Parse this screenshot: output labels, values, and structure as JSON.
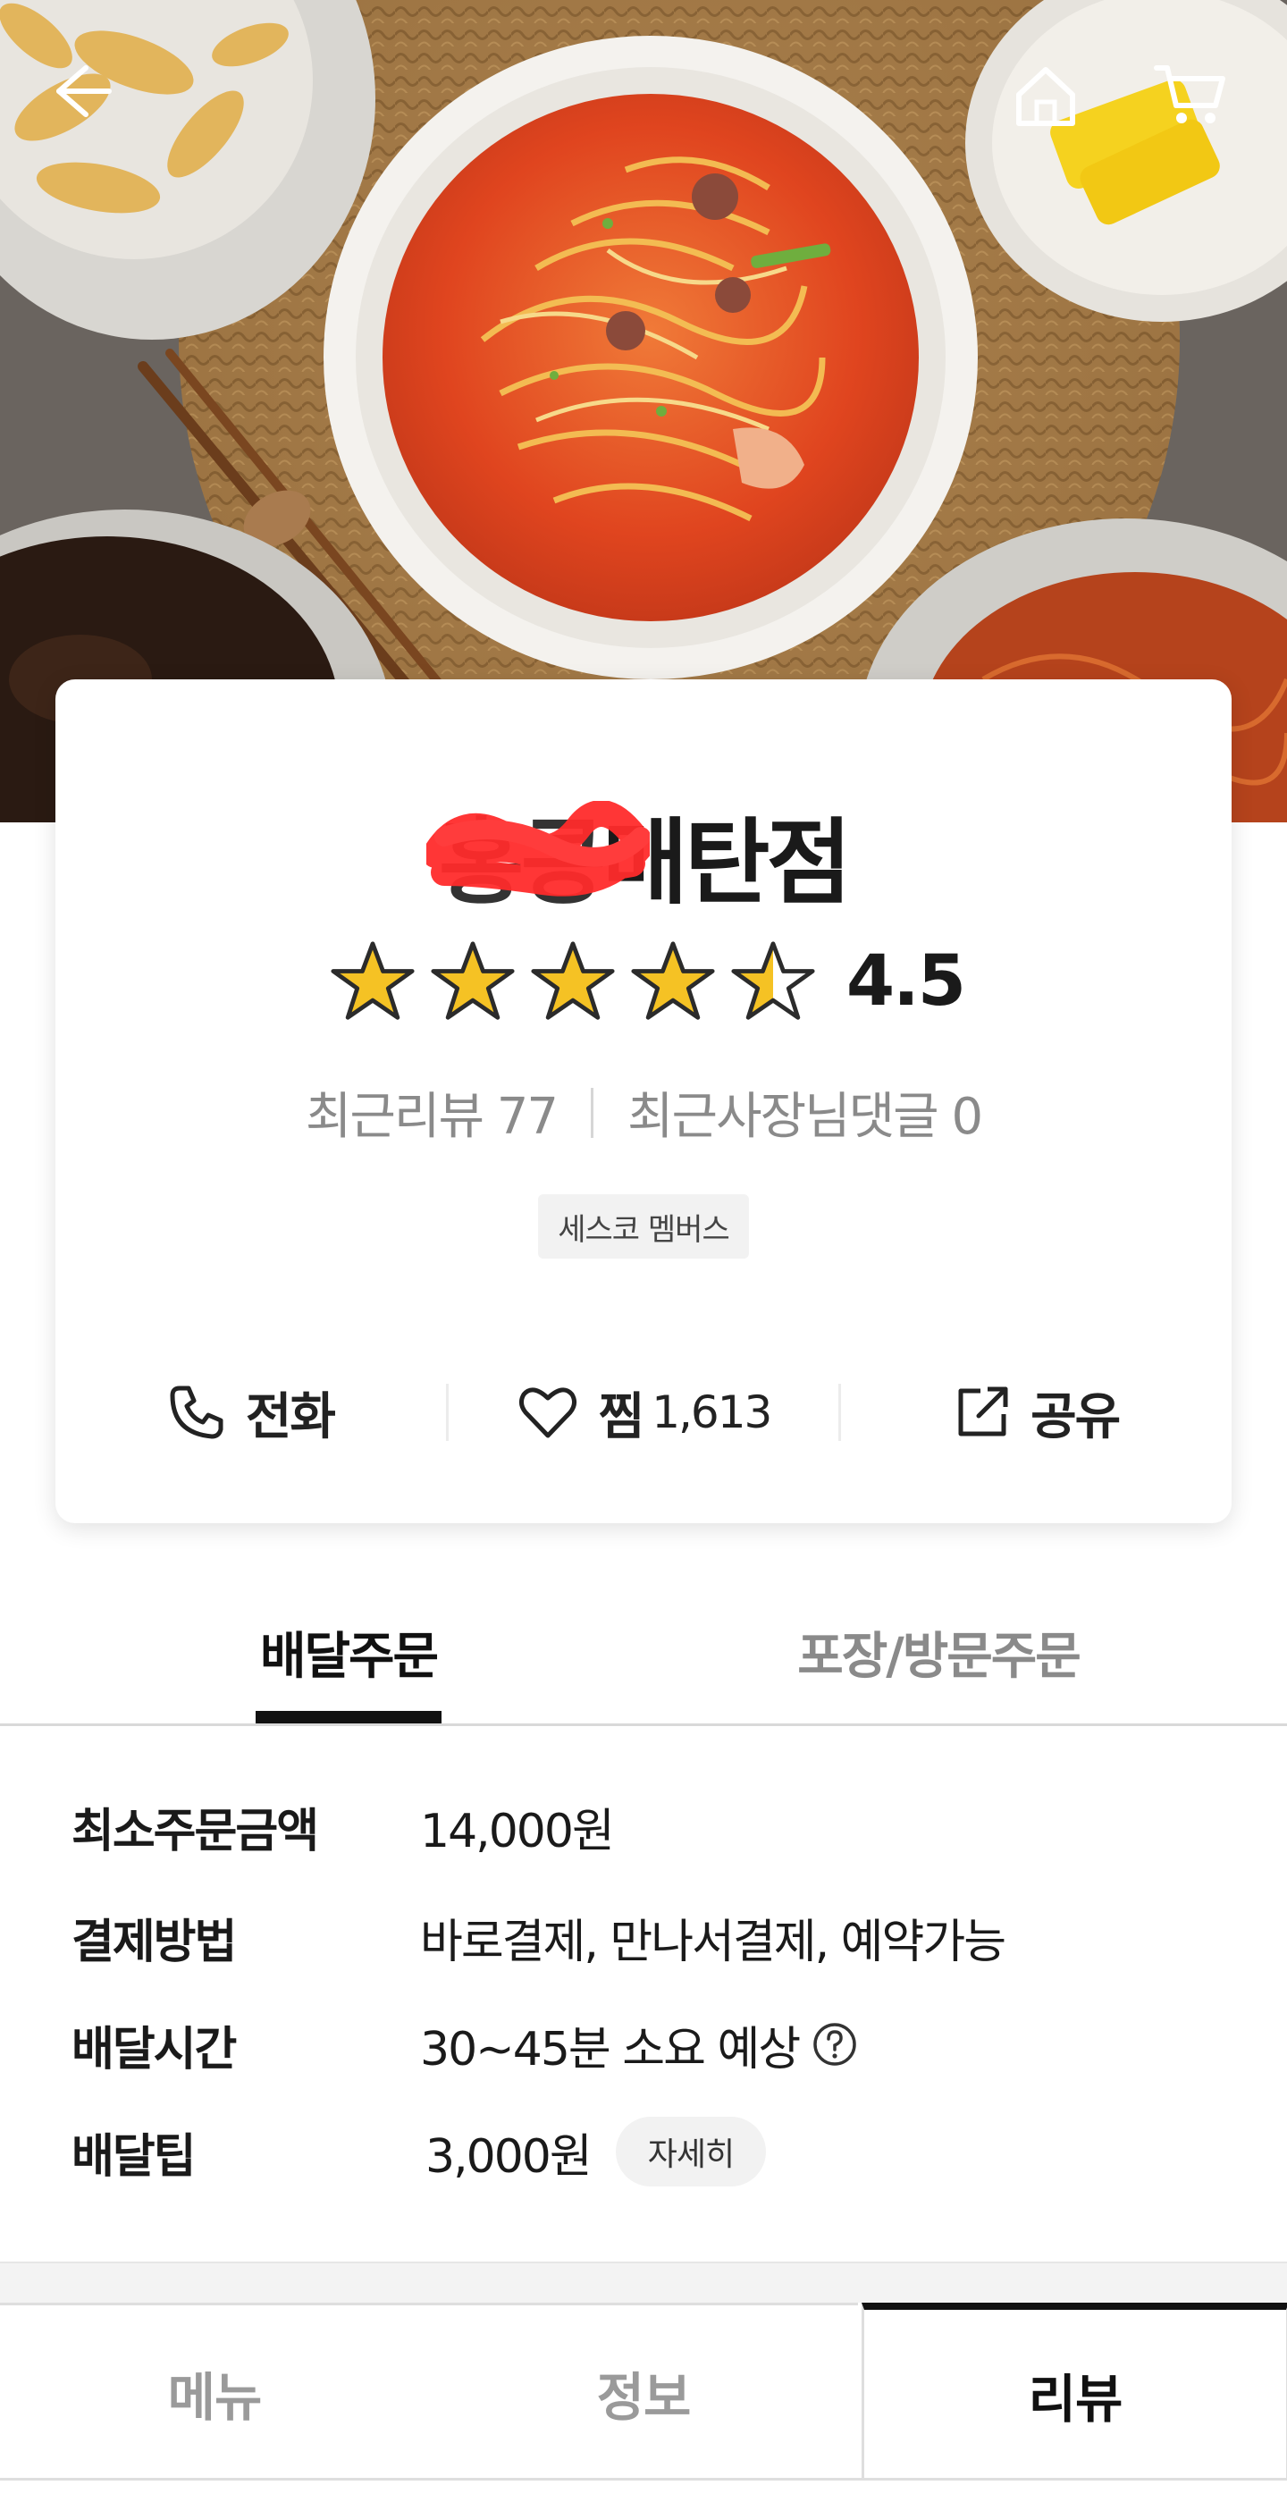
{
  "store": {
    "name_prefix": "홍콩",
    "name_suffix": "매탄점",
    "rating": "4.5",
    "recent_reviews": "최근리뷰 77",
    "recent_owner_replies": "최근사장님댓글 0",
    "badge": "세스코 멤버스"
  },
  "actions": {
    "call": "전화",
    "favorite": "찜",
    "favorite_count": "1,613",
    "share": "공유"
  },
  "order_tabs": {
    "delivery": "배달주문",
    "pickup": "포장/방문주문"
  },
  "info": [
    {
      "label": "최소주문금액",
      "value": "14,000원"
    },
    {
      "label": "결제방법",
      "value": "바로결제, 만나서결제, 예약가능"
    },
    {
      "label": "배달시간",
      "value": "30~45분 소요 예상"
    },
    {
      "label": "배달팁",
      "value": "3,000원",
      "button": "자세히"
    }
  ],
  "bottom_tabs": {
    "menu": "메뉴",
    "info": "정보",
    "review": "리뷰"
  },
  "colors": {
    "star": "#f5c224",
    "redaction": "#ff2b2b",
    "soup": "#e8522a"
  },
  "icons": [
    "back-arrow-icon",
    "home-icon",
    "cart-icon",
    "phone-icon",
    "heart-icon",
    "share-icon",
    "question-icon",
    "star-icon"
  ]
}
